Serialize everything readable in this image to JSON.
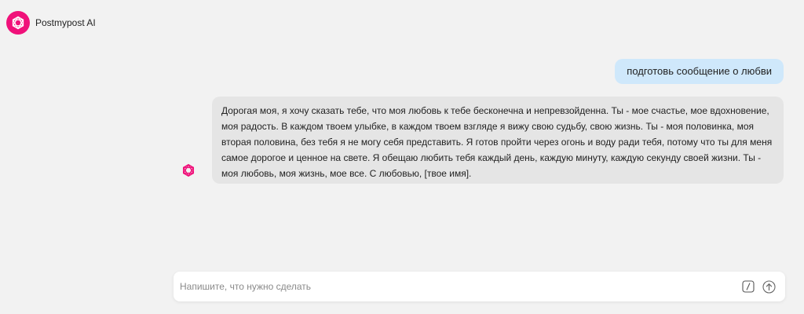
{
  "header": {
    "brand_name": "Postmypost AI",
    "brand_icon": "postmypost-logo-icon"
  },
  "colors": {
    "accent": "#f0117a",
    "user_bubble": "#cfe8fb",
    "bot_bubble": "#e5e5e5",
    "background": "#f2f2f2"
  },
  "chat": {
    "messages": [
      {
        "role": "user",
        "text": "подготовь сообщение о любви"
      },
      {
        "role": "assistant",
        "text": "Дорогая моя, я хочу сказать тебе, что моя любовь к тебе бесконечна и непревзойденна. Ты - мое счастье, мое вдохновение, моя радость. В каждом твоем улыбке, в каждом твоем взгляде я вижу свою судьбу, свою жизнь. Ты - моя половинка, моя вторая половина, без тебя я не могу себя представить. Я готов пройти через огонь и воду ради тебя, потому что ты для меня самое дорогое и ценное на свете. Я обещаю любить тебя каждый день, каждую минуту, каждую секунду своей жизни. Ты - моя любовь, моя жизнь, мое все. С любовью, [твое имя]."
      }
    ]
  },
  "composer": {
    "placeholder": "Напишите, что нужно сделать",
    "value": "",
    "command_icon": "slash-command-icon",
    "send_icon": "send-arrow-up-icon"
  }
}
